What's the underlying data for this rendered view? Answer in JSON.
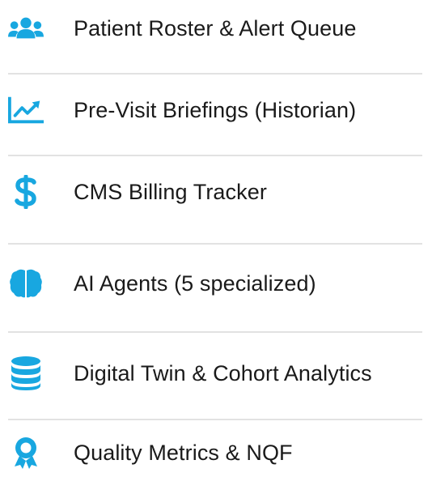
{
  "accent_color": "#18a7e0",
  "menu": {
    "items": [
      {
        "label": "Patient Roster & Alert Queue",
        "icon": "users-icon"
      },
      {
        "label": "Pre-Visit Briefings (Historian)",
        "icon": "chart-line-icon"
      },
      {
        "label": "CMS Billing Tracker",
        "icon": "dollar-sign-icon"
      },
      {
        "label": "AI Agents (5 specialized)",
        "icon": "brain-icon"
      },
      {
        "label": "Digital Twin & Cohort Analytics",
        "icon": "database-icon"
      },
      {
        "label": "Quality Metrics & NQF",
        "icon": "award-icon"
      }
    ]
  }
}
